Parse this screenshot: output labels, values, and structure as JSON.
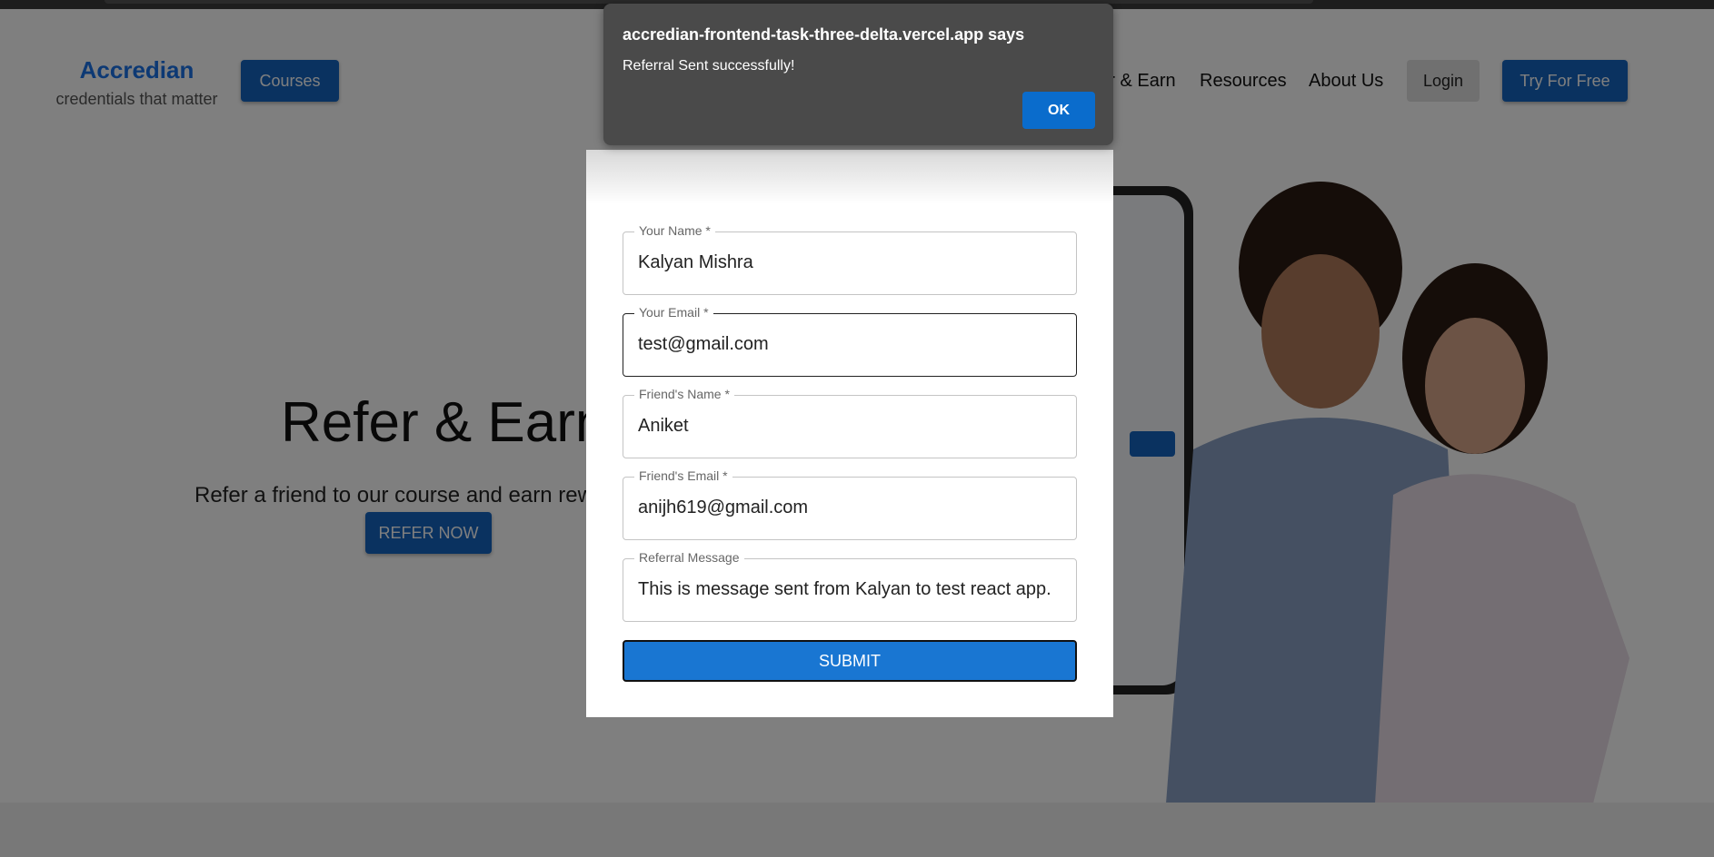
{
  "header": {
    "logo": "Accredian",
    "tagline": "credentials that matter",
    "courses": "Courses",
    "nav": [
      "Refer & Earn",
      "Resources",
      "About Us"
    ],
    "login": "Login",
    "try_free": "Try For Free"
  },
  "hero": {
    "title": "Refer & Earn",
    "subtitle": "Refer a friend to our course and earn rewards",
    "cta": "REFER NOW"
  },
  "form": {
    "fields": [
      {
        "label": "Your Name *",
        "value": "Kalyan Mishra"
      },
      {
        "label": "Your Email *",
        "value": "test@gmail.com"
      },
      {
        "label": "Friend's Name *",
        "value": "Aniket"
      },
      {
        "label": "Friend's Email *",
        "value": "anijh619@gmail.com"
      },
      {
        "label": "Referral Message",
        "value": "This is message sent from Kalyan to test react app."
      }
    ],
    "submit": "SUBMIT"
  },
  "alert": {
    "title": "accredian-frontend-task-three-delta.vercel.app says",
    "message": "Referral Sent successfully!",
    "ok": "OK"
  },
  "colors": {
    "primary": "#1565c0",
    "submit": "#1976d2",
    "alert_bg": "#4a4a4a",
    "alert_ok": "#0a6ccc"
  }
}
